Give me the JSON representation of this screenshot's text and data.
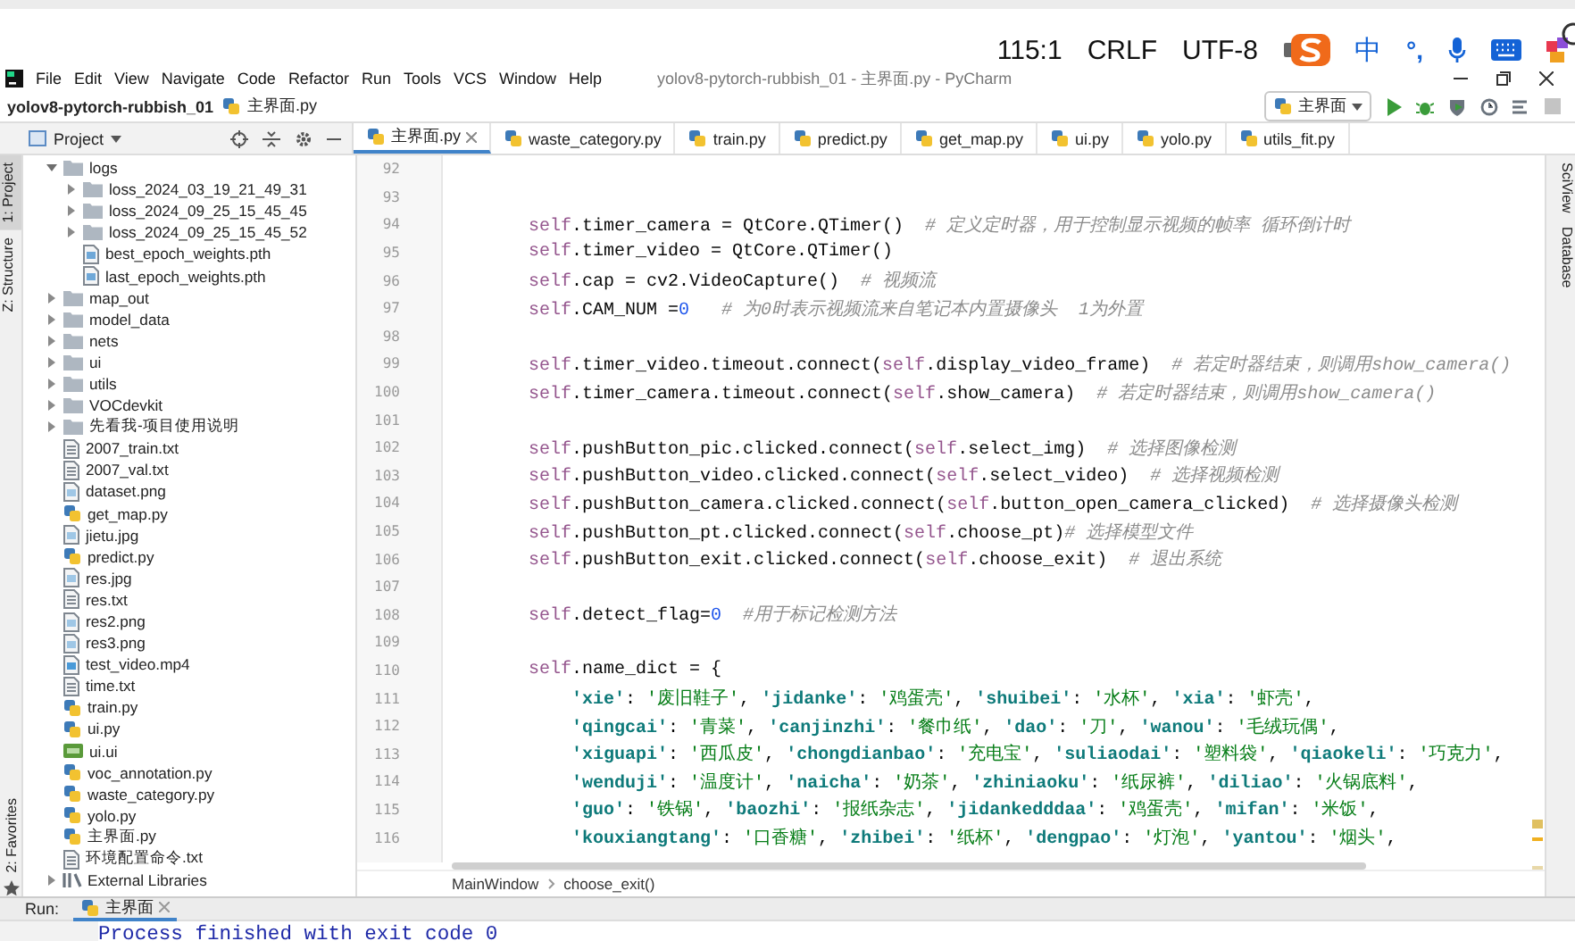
{
  "status_bar": {
    "position": "115:1",
    "line_separator": "CRLF",
    "encoding": "UTF-8"
  },
  "ime_toolbar": {
    "mode": "中",
    "punctuation": "°,"
  },
  "menu": [
    "File",
    "Edit",
    "View",
    "Navigate",
    "Code",
    "Refactor",
    "Run",
    "Tools",
    "VCS",
    "Window",
    "Help"
  ],
  "window": {
    "title": "yolov8-pytorch-rubbish_01 - 主界面.py - PyCharm"
  },
  "navigation": {
    "project": "yolov8-pytorch-rubbish_01",
    "file": "主界面.py",
    "run_config": "主界面"
  },
  "left_strip": [
    {
      "label": "1: Project",
      "selected": true
    },
    {
      "label": "Z: Structure",
      "selected": false
    }
  ],
  "favorites": "2: Favorites",
  "project_panel": {
    "title": "Project",
    "tree": [
      {
        "name": "logs",
        "kind": "folder",
        "expanded": true,
        "children": [
          {
            "name": "loss_2024_03_19_21_49_31",
            "kind": "folder",
            "expanded": false
          },
          {
            "name": "loss_2024_09_25_15_45_45",
            "kind": "folder",
            "expanded": false
          },
          {
            "name": "loss_2024_09_25_15_45_52",
            "kind": "folder",
            "expanded": false
          },
          {
            "name": "best_epoch_weights.pth",
            "kind": "pth"
          },
          {
            "name": "last_epoch_weights.pth",
            "kind": "pth"
          }
        ]
      },
      {
        "name": "map_out",
        "kind": "folder",
        "expanded": false
      },
      {
        "name": "model_data",
        "kind": "folder",
        "expanded": false
      },
      {
        "name": "nets",
        "kind": "folder",
        "expanded": false
      },
      {
        "name": "ui",
        "kind": "folder",
        "expanded": false
      },
      {
        "name": "utils",
        "kind": "folder",
        "expanded": false
      },
      {
        "name": "VOCdevkit",
        "kind": "folder",
        "expanded": false
      },
      {
        "name": "先看我-项目使用说明",
        "kind": "folder",
        "expanded": false
      },
      {
        "name": "2007_train.txt",
        "kind": "txt"
      },
      {
        "name": "2007_val.txt",
        "kind": "txt"
      },
      {
        "name": "dataset.png",
        "kind": "image"
      },
      {
        "name": "get_map.py",
        "kind": "py"
      },
      {
        "name": "jietu.jpg",
        "kind": "image"
      },
      {
        "name": "predict.py",
        "kind": "py"
      },
      {
        "name": "res.jpg",
        "kind": "image"
      },
      {
        "name": "res.txt",
        "kind": "txt"
      },
      {
        "name": "res2.png",
        "kind": "image"
      },
      {
        "name": "res3.png",
        "kind": "image"
      },
      {
        "name": "test_video.mp4",
        "kind": "video"
      },
      {
        "name": "time.txt",
        "kind": "txt"
      },
      {
        "name": "train.py",
        "kind": "py"
      },
      {
        "name": "ui.py",
        "kind": "py"
      },
      {
        "name": "ui.ui",
        "kind": "ui"
      },
      {
        "name": "voc_annotation.py",
        "kind": "py"
      },
      {
        "name": "waste_category.py",
        "kind": "py"
      },
      {
        "name": "yolo.py",
        "kind": "py"
      },
      {
        "name": "主界面.py",
        "kind": "py"
      },
      {
        "name": "环境配置命令.txt",
        "kind": "txt"
      },
      {
        "name": "External Libraries",
        "kind": "library",
        "expanded": false
      }
    ]
  },
  "tabs": [
    {
      "label": "主界面.py",
      "selected": true
    },
    {
      "label": "waste_category.py",
      "selected": false
    },
    {
      "label": "train.py",
      "selected": false
    },
    {
      "label": "predict.py",
      "selected": false
    },
    {
      "label": "get_map.py",
      "selected": false
    },
    {
      "label": "ui.py",
      "selected": false
    },
    {
      "label": "yolo.py",
      "selected": false
    },
    {
      "label": "utils_fit.py",
      "selected": false
    }
  ],
  "editor": {
    "lines": [
      {
        "number": "92"
      },
      {
        "number": "93"
      },
      {
        "number": "94",
        "tokens": [
          {
            "kind": "self",
            "text": "self"
          },
          {
            "kind": "plain",
            "text": ".timer_camera = QtCore.QTimer()"
          },
          {
            "kind": "comment",
            "text": "  # 定义定时器，用于控制显示视频的帧率 循环倒计时"
          }
        ]
      },
      {
        "number": "95",
        "tokens": [
          {
            "kind": "self",
            "text": "self"
          },
          {
            "kind": "plain",
            "text": ".timer_video = QtCore.QTimer()"
          }
        ]
      },
      {
        "number": "96",
        "tokens": [
          {
            "kind": "self",
            "text": "self"
          },
          {
            "kind": "plain",
            "text": ".cap = cv2.VideoCapture()"
          },
          {
            "kind": "comment",
            "text": "  # 视频流"
          }
        ]
      },
      {
        "number": "97",
        "tokens": [
          {
            "kind": "self",
            "text": "self"
          },
          {
            "kind": "plain",
            "text": ".CAM_NUM ="
          },
          {
            "kind": "number",
            "text": "0"
          },
          {
            "kind": "comment",
            "text": "   # 为0时表示视频流来自笔记本内置摄像头  1为外置"
          }
        ]
      },
      {
        "number": "98"
      },
      {
        "number": "99",
        "tokens": [
          {
            "kind": "self",
            "text": "self"
          },
          {
            "kind": "plain",
            "text": ".timer_video.timeout.connect("
          },
          {
            "kind": "self",
            "text": "self"
          },
          {
            "kind": "plain",
            "text": ".display_video_frame)"
          },
          {
            "kind": "comment",
            "text": "  # 若定时器结束，则调用show_camera()"
          }
        ]
      },
      {
        "number": "100",
        "tokens": [
          {
            "kind": "self",
            "text": "self"
          },
          {
            "kind": "plain",
            "text": ".timer_camera.timeout.connect("
          },
          {
            "kind": "self",
            "text": "self"
          },
          {
            "kind": "plain",
            "text": ".show_camera)"
          },
          {
            "kind": "comment",
            "text": "  # 若定时器结束，则调用show_camera()"
          }
        ]
      },
      {
        "number": "101"
      },
      {
        "number": "102",
        "tokens": [
          {
            "kind": "self",
            "text": "self"
          },
          {
            "kind": "plain",
            "text": ".pushButton_pic.clicked.connect("
          },
          {
            "kind": "self",
            "text": "self"
          },
          {
            "kind": "plain",
            "text": ".select_img)"
          },
          {
            "kind": "comment",
            "text": "  # 选择图像检测"
          }
        ]
      },
      {
        "number": "103",
        "tokens": [
          {
            "kind": "self",
            "text": "self"
          },
          {
            "kind": "plain",
            "text": ".pushButton_video.clicked.connect("
          },
          {
            "kind": "self",
            "text": "self"
          },
          {
            "kind": "plain",
            "text": ".select_video)"
          },
          {
            "kind": "comment",
            "text": "  # 选择视频检测"
          }
        ]
      },
      {
        "number": "104",
        "tokens": [
          {
            "kind": "self",
            "text": "self"
          },
          {
            "kind": "plain",
            "text": ".pushButton_camera.clicked.connect("
          },
          {
            "kind": "self",
            "text": "self"
          },
          {
            "kind": "plain",
            "text": ".button_open_camera_clicked)"
          },
          {
            "kind": "comment",
            "text": "  # 选择摄像头检测"
          }
        ]
      },
      {
        "number": "105",
        "tokens": [
          {
            "kind": "self",
            "text": "self"
          },
          {
            "kind": "plain",
            "text": ".pushButton_pt.clicked.connect("
          },
          {
            "kind": "self",
            "text": "self"
          },
          {
            "kind": "plain",
            "text": ".choose_pt)"
          },
          {
            "kind": "comment",
            "text": "# 选择模型文件"
          }
        ]
      },
      {
        "number": "106",
        "tokens": [
          {
            "kind": "self",
            "text": "self"
          },
          {
            "kind": "plain",
            "text": ".pushButton_exit.clicked.connect("
          },
          {
            "kind": "self",
            "text": "self"
          },
          {
            "kind": "plain",
            "text": ".choose_exit)"
          },
          {
            "kind": "comment",
            "text": "  # 退出系统"
          }
        ]
      },
      {
        "number": "107"
      },
      {
        "number": "108",
        "tokens": [
          {
            "kind": "self",
            "text": "self"
          },
          {
            "kind": "plain",
            "text": ".detect_flag="
          },
          {
            "kind": "number",
            "text": "0"
          },
          {
            "kind": "comment",
            "text": "  #用于标记检测方法"
          }
        ]
      },
      {
        "number": "109"
      },
      {
        "number": "110",
        "tokens": [
          {
            "kind": "self",
            "text": "self"
          },
          {
            "kind": "plain",
            "text": ".name_dict = {"
          }
        ],
        "children": [
          {
            "number": "111",
            "tokens": [
              {
                "kind": "key",
                "text": "'xie'"
              },
              {
                "kind": "plain",
                "text": ": "
              },
              {
                "kind": "string",
                "text": "'废旧鞋子'"
              },
              {
                "kind": "plain",
                "text": ", "
              },
              {
                "kind": "key",
                "text": "'jidanke'"
              },
              {
                "kind": "plain",
                "text": ": "
              },
              {
                "kind": "string",
                "text": "'鸡蛋壳'"
              },
              {
                "kind": "plain",
                "text": ", "
              },
              {
                "kind": "key",
                "text": "'shuibei'"
              },
              {
                "kind": "plain",
                "text": ": "
              },
              {
                "kind": "string",
                "text": "'水杯'"
              },
              {
                "kind": "plain",
                "text": ", "
              },
              {
                "kind": "key",
                "text": "'xia'"
              },
              {
                "kind": "plain",
                "text": ": "
              },
              {
                "kind": "string",
                "text": "'虾壳'"
              },
              {
                "kind": "plain",
                "text": ","
              }
            ]
          },
          {
            "number": "112",
            "tokens": [
              {
                "kind": "key",
                "text": "'qingcai'"
              },
              {
                "kind": "plain",
                "text": ": "
              },
              {
                "kind": "string",
                "text": "'青菜'"
              },
              {
                "kind": "plain",
                "text": ", "
              },
              {
                "kind": "key",
                "text": "'canjinzhi'"
              },
              {
                "kind": "plain",
                "text": ": "
              },
              {
                "kind": "string",
                "text": "'餐巾纸'"
              },
              {
                "kind": "plain",
                "text": ", "
              },
              {
                "kind": "key",
                "text": "'dao'"
              },
              {
                "kind": "plain",
                "text": ": "
              },
              {
                "kind": "string",
                "text": "'刀'"
              },
              {
                "kind": "plain",
                "text": ", "
              },
              {
                "kind": "key",
                "text": "'wanou'"
              },
              {
                "kind": "plain",
                "text": ": "
              },
              {
                "kind": "string",
                "text": "'毛绒玩偶'"
              },
              {
                "kind": "plain",
                "text": ","
              }
            ]
          },
          {
            "number": "113",
            "tokens": [
              {
                "kind": "key",
                "text": "'xiguapi'"
              },
              {
                "kind": "plain",
                "text": ": "
              },
              {
                "kind": "string",
                "text": "'西瓜皮'"
              },
              {
                "kind": "plain",
                "text": ", "
              },
              {
                "kind": "key",
                "text": "'chongdianbao'"
              },
              {
                "kind": "plain",
                "text": ": "
              },
              {
                "kind": "string",
                "text": "'充电宝'"
              },
              {
                "kind": "plain",
                "text": ", "
              },
              {
                "kind": "key",
                "text": "'suliaodai'"
              },
              {
                "kind": "plain",
                "text": ": "
              },
              {
                "kind": "string",
                "text": "'塑料袋'"
              },
              {
                "kind": "plain",
                "text": ", "
              },
              {
                "kind": "key",
                "text": "'qiaokeli'"
              },
              {
                "kind": "plain",
                "text": ": "
              },
              {
                "kind": "string",
                "text": "'巧克力'"
              },
              {
                "kind": "plain",
                "text": ","
              }
            ]
          },
          {
            "number": "114",
            "tokens": [
              {
                "kind": "key",
                "text": "'wenduji'"
              },
              {
                "kind": "plain",
                "text": ": "
              },
              {
                "kind": "string",
                "text": "'温度计'"
              },
              {
                "kind": "plain",
                "text": ", "
              },
              {
                "kind": "key",
                "text": "'naicha'"
              },
              {
                "kind": "plain",
                "text": ": "
              },
              {
                "kind": "string",
                "text": "'奶茶'"
              },
              {
                "kind": "plain",
                "text": ", "
              },
              {
                "kind": "key",
                "text": "'zhiniaoku'"
              },
              {
                "kind": "plain",
                "text": ": "
              },
              {
                "kind": "string",
                "text": "'纸尿裤'"
              },
              {
                "kind": "plain",
                "text": ", "
              },
              {
                "kind": "key",
                "text": "'diliao'"
              },
              {
                "kind": "plain",
                "text": ": "
              },
              {
                "kind": "string",
                "text": "'火锅底料'"
              },
              {
                "kind": "plain",
                "text": ","
              }
            ]
          },
          {
            "number": "115",
            "tokens": [
              {
                "kind": "key",
                "text": "'guo'"
              },
              {
                "kind": "plain",
                "text": ": "
              },
              {
                "kind": "string",
                "text": "'铁锅'"
              },
              {
                "kind": "plain",
                "text": ", "
              },
              {
                "kind": "key",
                "text": "'baozhi'"
              },
              {
                "kind": "plain",
                "text": ": "
              },
              {
                "kind": "string",
                "text": "'报纸杂志'"
              },
              {
                "kind": "plain",
                "text": ", "
              },
              {
                "kind": "key",
                "text": "'jidankedddaa'"
              },
              {
                "kind": "plain",
                "text": ": "
              },
              {
                "kind": "string",
                "text": "'鸡蛋壳'"
              },
              {
                "kind": "plain",
                "text": ", "
              },
              {
                "kind": "key",
                "text": "'mifan'"
              },
              {
                "kind": "plain",
                "text": ": "
              },
              {
                "kind": "string",
                "text": "'米饭'"
              },
              {
                "kind": "plain",
                "text": ","
              }
            ]
          },
          {
            "number": "116",
            "tokens": [
              {
                "kind": "key",
                "text": "'kouxiangtang'"
              },
              {
                "kind": "plain",
                "text": ": "
              },
              {
                "kind": "string",
                "text": "'口香糖'"
              },
              {
                "kind": "plain",
                "text": ", "
              },
              {
                "kind": "key",
                "text": "'zhibei'"
              },
              {
                "kind": "plain",
                "text": ": "
              },
              {
                "kind": "string",
                "text": "'纸杯'"
              },
              {
                "kind": "plain",
                "text": ", "
              },
              {
                "kind": "key",
                "text": "'dengpao'"
              },
              {
                "kind": "plain",
                "text": ": "
              },
              {
                "kind": "string",
                "text": "'灯泡'"
              },
              {
                "kind": "plain",
                "text": ", "
              },
              {
                "kind": "key",
                "text": "'yantou'"
              },
              {
                "kind": "plain",
                "text": ": "
              },
              {
                "kind": "string",
                "text": "'烟头'"
              },
              {
                "kind": "plain",
                "text": ","
              }
            ]
          }
        ]
      }
    ],
    "breadcrumbs": [
      "MainWindow",
      "choose_exit()"
    ]
  },
  "right_strip": [
    "SciView",
    "Database"
  ],
  "run": {
    "label": "Run:",
    "tab": "主界面",
    "output": "Process finished with exit code 0"
  }
}
